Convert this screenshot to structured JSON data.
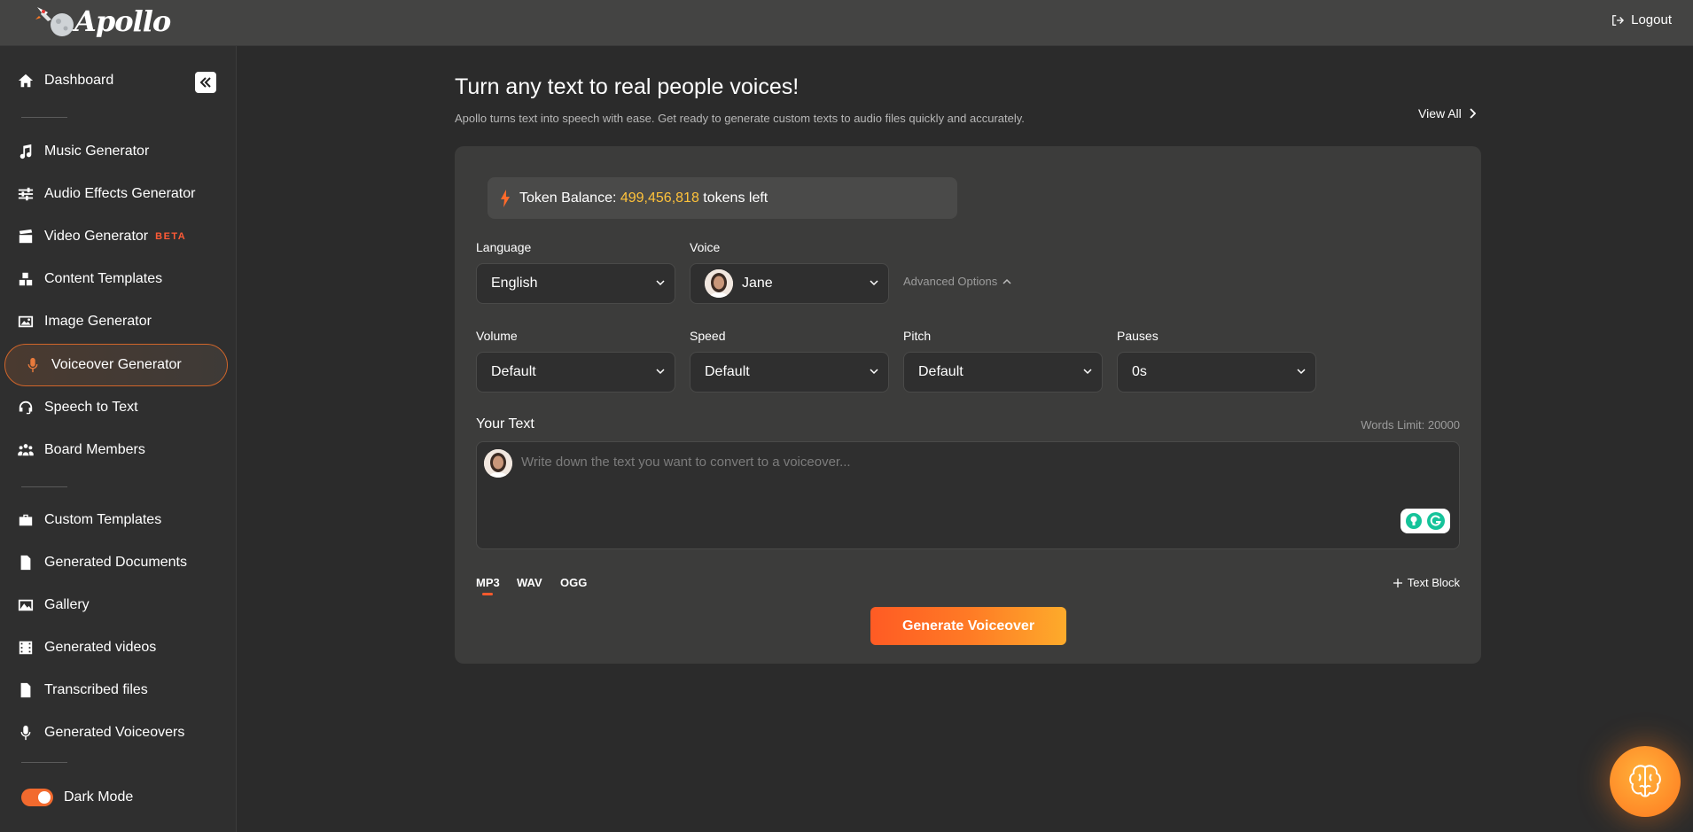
{
  "app": {
    "name": "Apollo",
    "logout_label": "Logout"
  },
  "sidebar": {
    "dashboard": "Dashboard",
    "items": [
      {
        "label": "Music Generator",
        "icon": "music-icon"
      },
      {
        "label": "Audio Effects Generator",
        "icon": "sliders-icon"
      },
      {
        "label": "Video Generator",
        "icon": "clapperboard-icon",
        "badge": "BETA"
      },
      {
        "label": "Content Templates",
        "icon": "blocks-icon"
      },
      {
        "label": "Image Generator",
        "icon": "image-icon"
      },
      {
        "label": "Voiceover Generator",
        "icon": "microphone-icon",
        "active": true
      },
      {
        "label": "Speech to Text",
        "icon": "headset-icon"
      },
      {
        "label": "Board Members",
        "icon": "users-icon"
      }
    ],
    "items2": [
      {
        "label": "Custom Templates",
        "icon": "toolbox-icon"
      },
      {
        "label": "Generated Documents",
        "icon": "document-icon"
      },
      {
        "label": "Gallery",
        "icon": "gallery-icon"
      },
      {
        "label": "Generated videos",
        "icon": "film-icon"
      },
      {
        "label": "Transcribed files",
        "icon": "file-audio-icon"
      },
      {
        "label": "Generated Voiceovers",
        "icon": "microphone-icon"
      }
    ],
    "dark_mode_label": "Dark Mode",
    "dark_mode_on": true
  },
  "main": {
    "title": "Turn any text to real people voices!",
    "subtitle": "Apollo turns text into speech with ease. Get ready to generate custom texts to audio files quickly and accurately.",
    "view_all": "View All",
    "token": {
      "prefix": "Token Balance:",
      "amount": "499,456,818",
      "suffix": "tokens left"
    },
    "language": {
      "label": "Language",
      "value": "English"
    },
    "voice": {
      "label": "Voice",
      "value": "Jane"
    },
    "advanced_options": "Advanced Options",
    "volume": {
      "label": "Volume",
      "value": "Default"
    },
    "speed": {
      "label": "Speed",
      "value": "Default"
    },
    "pitch": {
      "label": "Pitch",
      "value": "Default"
    },
    "pauses": {
      "label": "Pauses",
      "value": "0s"
    },
    "your_text": {
      "label": "Your Text",
      "words_limit": "Words Limit: 20000",
      "placeholder": "Write down the text you want to convert to a voiceover..."
    },
    "formats": [
      "MP3",
      "WAV",
      "OGG"
    ],
    "active_format": "MP3",
    "text_block": "Text Block",
    "generate": "Generate Voiceover"
  },
  "colors": {
    "accent": "#ff5a2d",
    "token_amount": "#ffc23a",
    "background": "#2b2b2b",
    "card": "#3c3c3b"
  }
}
